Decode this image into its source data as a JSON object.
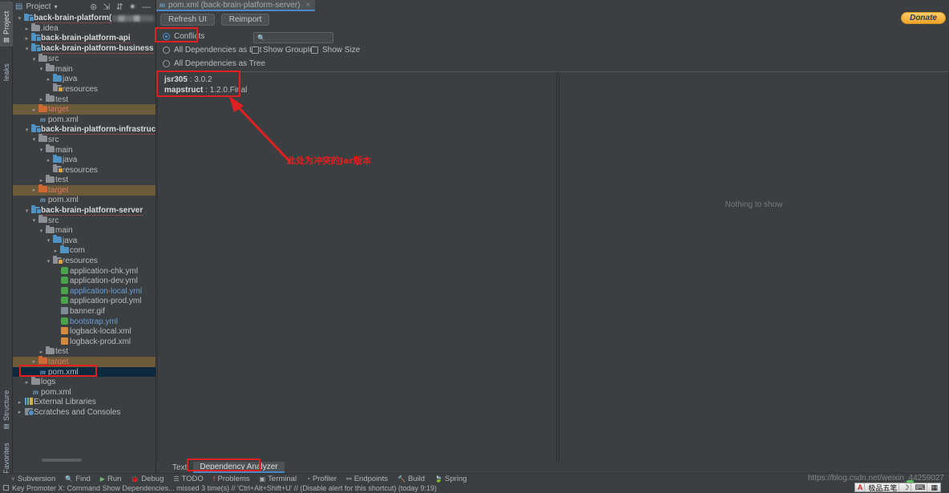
{
  "left_tool_tabs": [
    {
      "label": "Project",
      "icon": "project-icon",
      "selected": true
    },
    {
      "label": "leaks",
      "icon": "leaks-icon",
      "selected": false
    },
    {
      "label": "Structure",
      "icon": "structure-icon",
      "selected": false
    },
    {
      "label": "Favorites",
      "icon": "star-icon",
      "selected": false
    }
  ],
  "project_panel": {
    "title": "Project",
    "dropdown_caret": "▾",
    "header_icons": [
      "target-scope-icon",
      "collapse-icon",
      "expand-icon",
      "settings-gear-icon",
      "hide-icon"
    ],
    "tree": [
      {
        "indent": 0,
        "arrow": "v",
        "icon": "module-folder",
        "label": "back-brain-platform(",
        "bold": true,
        "redacted": true
      },
      {
        "indent": 1,
        "arrow": ">",
        "icon": "folder",
        "label": ".idea"
      },
      {
        "indent": 1,
        "arrow": ">",
        "icon": "module-folder",
        "label": "back-brain-platform-api",
        "bold": true
      },
      {
        "indent": 1,
        "arrow": "v",
        "icon": "module-folder",
        "label": "back-brain-platform-business",
        "bold": true
      },
      {
        "indent": 2,
        "arrow": "v",
        "icon": "folder",
        "label": "src"
      },
      {
        "indent": 3,
        "arrow": "v",
        "icon": "folder",
        "label": "main"
      },
      {
        "indent": 4,
        "arrow": ">",
        "icon": "source-folder",
        "label": "java"
      },
      {
        "indent": 4,
        "arrow": "",
        "icon": "resource-folder",
        "label": "resources"
      },
      {
        "indent": 3,
        "arrow": ">",
        "icon": "folder",
        "label": "test"
      },
      {
        "indent": 2,
        "arrow": ">",
        "icon": "target-folder",
        "label": "target",
        "target": true
      },
      {
        "indent": 2,
        "arrow": "",
        "icon": "maven-file",
        "label": "pom.xml"
      },
      {
        "indent": 1,
        "arrow": "v",
        "icon": "module-folder",
        "label": "back-brain-platform-infrastructure",
        "bold": true
      },
      {
        "indent": 2,
        "arrow": "v",
        "icon": "folder",
        "label": "src"
      },
      {
        "indent": 3,
        "arrow": "v",
        "icon": "folder",
        "label": "main"
      },
      {
        "indent": 4,
        "arrow": ">",
        "icon": "source-folder",
        "label": "java"
      },
      {
        "indent": 4,
        "arrow": "",
        "icon": "resource-folder",
        "label": "resources"
      },
      {
        "indent": 3,
        "arrow": ">",
        "icon": "folder",
        "label": "test"
      },
      {
        "indent": 2,
        "arrow": ">",
        "icon": "target-folder",
        "label": "target",
        "target": true
      },
      {
        "indent": 2,
        "arrow": "",
        "icon": "maven-file",
        "label": "pom.xml"
      },
      {
        "indent": 1,
        "arrow": "v",
        "icon": "module-folder",
        "label": "back-brain-platform-server",
        "bold": true
      },
      {
        "indent": 2,
        "arrow": "v",
        "icon": "folder",
        "label": "src"
      },
      {
        "indent": 3,
        "arrow": "v",
        "icon": "folder",
        "label": "main"
      },
      {
        "indent": 4,
        "arrow": "v",
        "icon": "source-folder",
        "label": "java"
      },
      {
        "indent": 5,
        "arrow": ">",
        "icon": "package-folder",
        "label": "com"
      },
      {
        "indent": 4,
        "arrow": "v",
        "icon": "resource-folder",
        "label": "resources"
      },
      {
        "indent": 5,
        "arrow": "",
        "icon": "yaml-file",
        "label": "application-chk.yml"
      },
      {
        "indent": 5,
        "arrow": "",
        "icon": "yaml-file",
        "label": "application-dev.yml"
      },
      {
        "indent": 5,
        "arrow": "",
        "icon": "yaml-file",
        "label": "application-local.yml",
        "link": true
      },
      {
        "indent": 5,
        "arrow": "",
        "icon": "yaml-file",
        "label": "application-prod.yml"
      },
      {
        "indent": 5,
        "arrow": "",
        "icon": "gif-file",
        "label": "banner.gif"
      },
      {
        "indent": 5,
        "arrow": "",
        "icon": "yaml-file",
        "label": "bootstrap.yml",
        "link": true
      },
      {
        "indent": 5,
        "arrow": "",
        "icon": "xml-file",
        "label": "logback-local.xml"
      },
      {
        "indent": 5,
        "arrow": "",
        "icon": "xml-file",
        "label": "logback-prod.xml"
      },
      {
        "indent": 3,
        "arrow": ">",
        "icon": "folder",
        "label": "test"
      },
      {
        "indent": 2,
        "arrow": ">",
        "icon": "target-folder",
        "label": "target",
        "target": true
      },
      {
        "indent": 2,
        "arrow": "",
        "icon": "maven-file",
        "label": "pom.xml",
        "selected": true,
        "highlight": true
      },
      {
        "indent": 1,
        "arrow": ">",
        "icon": "folder",
        "label": "logs"
      },
      {
        "indent": 1,
        "arrow": "",
        "icon": "maven-file",
        "label": "pom.xml"
      },
      {
        "indent": 0,
        "arrow": ">",
        "icon": "external-libraries",
        "label": "External Libraries"
      },
      {
        "indent": 0,
        "arrow": ">",
        "icon": "scratches-icon",
        "label": "Scratches and Consoles"
      }
    ]
  },
  "editor": {
    "tab": {
      "label": "pom.xml (back-brain-platform-server)",
      "icon": "maven-file-icon",
      "close": "×"
    },
    "toolbar": {
      "refresh_label": "Refresh UI",
      "reimport_label": "Reimport",
      "donate_label": "Donate"
    },
    "options": {
      "conflicts_label": "Conflicts",
      "all_deps_list_label": "All Dependencies as List",
      "all_deps_tree_label": "All Dependencies as Tree",
      "show_groupid_label": "Show GroupId",
      "show_size_label": "Show Size",
      "search_placeholder": "",
      "search_value": "",
      "selected_mode": "Conflicts"
    },
    "conflicts": [
      {
        "name": "jsr305",
        "separator": ":",
        "version": "3.0.2"
      },
      {
        "name": "mapstruct",
        "separator": ":",
        "version": "1.2.0.Final"
      }
    ],
    "right_pane_empty_text": "Nothing to show"
  },
  "annotation": {
    "text": "此处为冲突的Jar版本",
    "color": "#e02020"
  },
  "bottom_tabs": [
    {
      "label": "Text",
      "selected": false
    },
    {
      "label": "Dependency Analyzer",
      "selected": true
    }
  ],
  "bottom_bar": [
    {
      "label": "Subversion",
      "icon": "branch-icon"
    },
    {
      "label": "Find",
      "icon": "search-icon"
    },
    {
      "label": "Run",
      "icon": "play-icon"
    },
    {
      "label": "Debug",
      "icon": "bug-icon"
    },
    {
      "label": "TODO",
      "icon": "list-icon"
    },
    {
      "label": "Problems",
      "icon": "error-icon"
    },
    {
      "label": "Terminal",
      "icon": "terminal-icon"
    },
    {
      "label": "Profiler",
      "icon": "profiler-icon"
    },
    {
      "label": "Endpoints",
      "icon": "endpoints-icon"
    },
    {
      "label": "Build",
      "icon": "hammer-icon"
    },
    {
      "label": "Spring",
      "icon": "spring-leaf-icon"
    }
  ],
  "status_bar": {
    "icon": "notification-icon",
    "message": "Key Promoter X: Command Show Dependencies... missed 3 time(s) // 'Ctrl+Alt+Shift+U' // (Disable alert for this shortcut) (today 9:19)"
  },
  "watermark": {
    "text": "https://blog.csdn.net/weixin_44259027"
  },
  "ime_bar": {
    "logo": "A",
    "name": "极品五笔",
    "items": [
      "☽",
      "⌨",
      "▦"
    ]
  }
}
